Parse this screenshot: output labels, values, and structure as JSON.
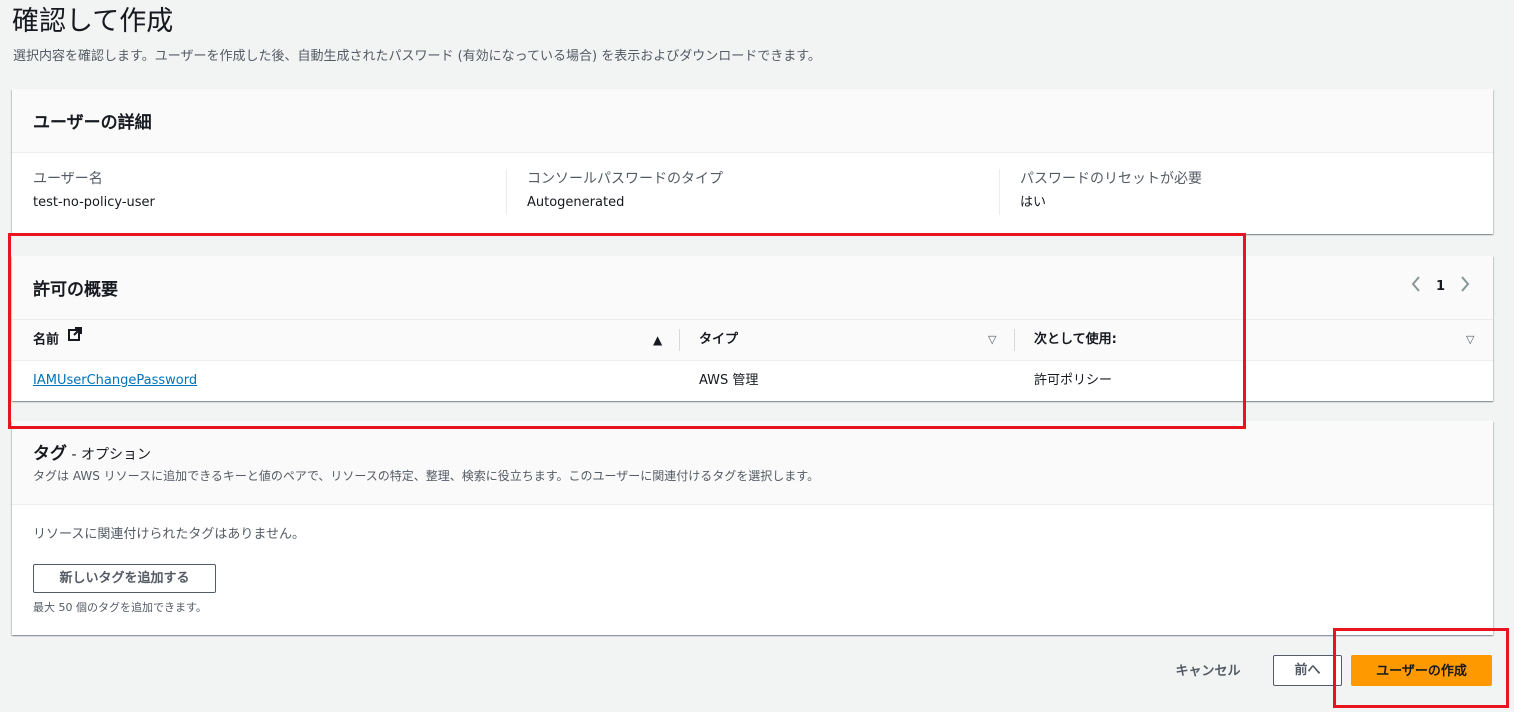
{
  "page": {
    "title": "確認して作成",
    "description": "選択内容を確認します。ユーザーを作成した後、自動生成されたパスワード (有効になっている場合) を表示およびダウンロードできます。"
  },
  "user_details": {
    "title": "ユーザーの詳細",
    "fields": [
      {
        "label": "ユーザー名",
        "value": "test-no-policy-user"
      },
      {
        "label": "コンソールパスワードのタイプ",
        "value": "Autogenerated"
      },
      {
        "label": "パスワードのリセットが必要",
        "value": "はい"
      }
    ]
  },
  "permissions": {
    "title": "許可の概要",
    "page_number": "1",
    "columns": [
      "名前",
      "タイプ",
      "次として使用:"
    ],
    "rows": [
      {
        "name": "IAMUserChangePassword",
        "type": "AWS 管理",
        "used_as": "許可ポリシー"
      }
    ]
  },
  "tags": {
    "title": "タグ",
    "optional": " - オプション",
    "description": "タグは AWS リソースに追加できるキーと値のペアで、リソースの特定、整理、検索に役立ちます。このユーザーに関連付けるタグを選択します。",
    "empty_message": "リソースに関連付けられたタグはありません。",
    "add_button": "新しいタグを追加する",
    "limit_text": "最大 50 個のタグを追加できます。"
  },
  "actions": {
    "cancel": "キャンセル",
    "previous": "前へ",
    "create": "ユーザーの作成"
  },
  "colors": {
    "primary_button": "#ff9900",
    "link": "#0073bb",
    "annotation": "#e8141e"
  },
  "icons": {
    "external_link": "external-link-icon",
    "sort_asc": "caret-up-icon",
    "sort": "caret-down-icon",
    "pager_prev": "chevron-left-icon",
    "pager_next": "chevron-right-icon"
  }
}
